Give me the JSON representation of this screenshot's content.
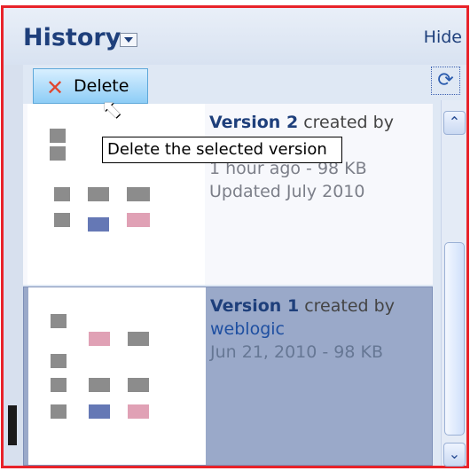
{
  "panel": {
    "title": "History",
    "hide_label": "Hide",
    "toolbar": {
      "delete_label": "Delete",
      "delete_icon": "delete-x-icon",
      "refresh_icon": "refresh-icon"
    },
    "tooltip": "Delete the selected version",
    "versions": [
      {
        "name": "Version 2",
        "created_by": "created by",
        "time": "1 hour ago",
        "size": "98 KB",
        "updated": "Updated July 2010"
      },
      {
        "name": "Version 1",
        "created_by": "created by",
        "author": "weblogic",
        "date": "Jun 21, 2010",
        "size": "98 KB"
      }
    ]
  },
  "colors": {
    "accent": "#1e3f7b",
    "border": "#e8232a",
    "selected": "#9aa9c9"
  }
}
